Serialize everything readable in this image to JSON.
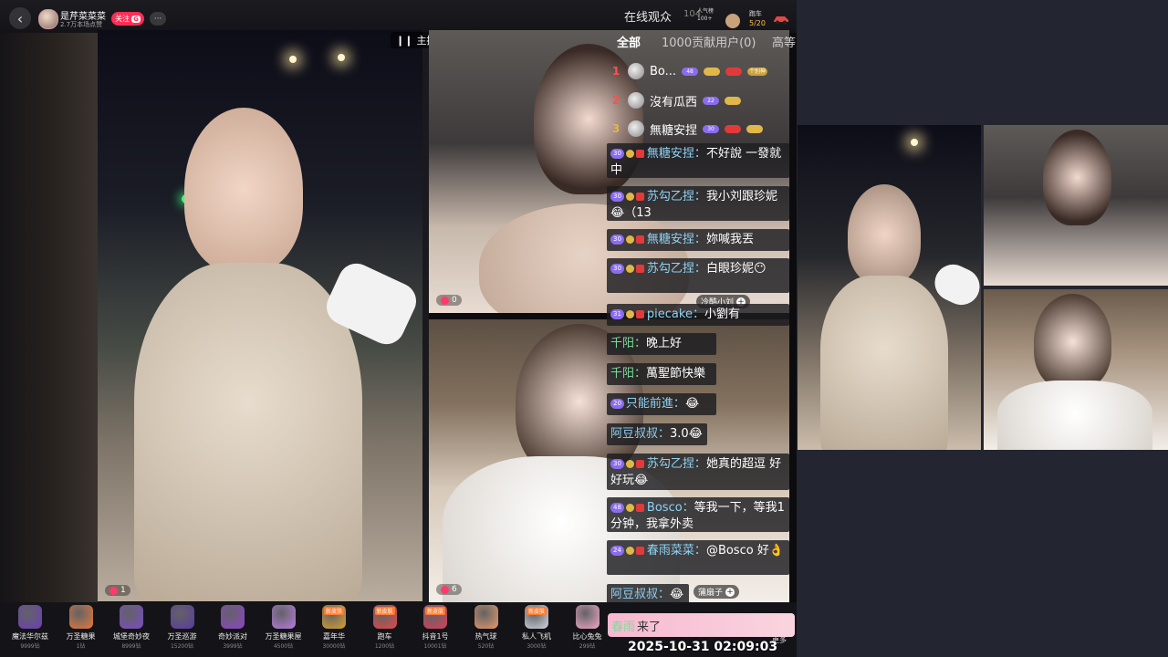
{
  "topbar": {
    "streamer_name": "是芹菜菜菜",
    "streamer_subtitle": "2.7万本场点赞",
    "follow_label": "关注",
    "follow_badge": "G",
    "more_label": "···",
    "audience_title": "在线观众",
    "audience_count": "104",
    "popularity_line1": "人气榜",
    "popularity_line2": "100+",
    "car_label": "跑车",
    "car_count": "5/20"
  },
  "stream": {
    "linking_label": "主播连线中",
    "main_badge_count": "1",
    "cohost_top_badge_count": "0",
    "cohost_bottom_badge_count": "6"
  },
  "chat_panel": {
    "tabs": [
      "全部",
      "1000贡献用户(0)",
      "高等"
    ],
    "top_contributors": [
      {
        "rank": "1",
        "name": "Bo...",
        "level": "48",
        "tag": "个别神"
      },
      {
        "rank": "2",
        "name": "沒有瓜西",
        "level": "22",
        "tag": ""
      },
      {
        "rank": "3",
        "name": "無糖安捏",
        "level": "30",
        "tag": ""
      }
    ],
    "messages": [
      {
        "level": "30",
        "nick": "無糖安捏：",
        "text": "不好說 一發就中"
      },
      {
        "level": "30",
        "nick": "苏勾乙捏：",
        "text": "我小刘跟珍妮😂（13"
      },
      {
        "level": "30",
        "nick": "無糖安捏：",
        "text": "妳喊我丟"
      },
      {
        "level": "30",
        "nick": "苏勾乙捏：",
        "text": "白眼珍妮😶"
      },
      {
        "level": "31",
        "nick": "piecake：",
        "text": "小劉有"
      },
      {
        "level": "",
        "nick": "千阳：",
        "text": "晚上好"
      },
      {
        "level": "",
        "nick": "千阳：",
        "text": "萬聖節快樂"
      },
      {
        "level": "20",
        "nick": "只能前進：",
        "text": "😂"
      },
      {
        "level": "",
        "nick": "阿豆叔叔：",
        "text": "3.0😂"
      },
      {
        "level": "30",
        "nick": "苏勾乙捏：",
        "text": "她真的超逗 好好玩😂"
      },
      {
        "level": "48",
        "nick": "Bosco：",
        "text": "等我一下，等我1分钟，我拿外卖"
      },
      {
        "level": "24",
        "nick": "春雨菜菜：",
        "text": "@Bosco 好👌"
      },
      {
        "level": "",
        "nick": "阿豆叔叔：",
        "text": "😂"
      }
    ],
    "pill_top": "冷酷小刘",
    "pill_bottom": "蒲扇子",
    "entry_banner_nick": "春雨",
    "entry_banner_text": "来了"
  },
  "timestamp": "2025-10-31 02:09:03",
  "gifts": [
    {
      "name": "魔法华尔兹",
      "price": "9999钻",
      "new": "",
      "color": "#6a3fb5"
    },
    {
      "name": "万圣糖果",
      "price": "1钻",
      "new": "",
      "color": "#e7783c"
    },
    {
      "name": "城堡奇妙夜",
      "price": "8999钻",
      "new": "",
      "color": "#7a4cc2"
    },
    {
      "name": "万圣巡游",
      "price": "15200钻",
      "new": "",
      "color": "#5b3aa0"
    },
    {
      "name": "奇妙派对",
      "price": "3999钻",
      "new": "",
      "color": "#8d44c9"
    },
    {
      "name": "万圣糖果屋",
      "price": "4500钻",
      "new": "",
      "color": "#b87be0"
    },
    {
      "name": "嘉年华",
      "price": "30000钻",
      "new": "新皮肤",
      "color": "#d7a22f"
    },
    {
      "name": "跑车",
      "price": "1200钻",
      "new": "新皮肤",
      "color": "#e24848"
    },
    {
      "name": "抖音1号",
      "price": "10001钻",
      "new": "新皮肤",
      "color": "#d6405b"
    },
    {
      "name": "热气球",
      "price": "520钻",
      "new": "",
      "color": "#e79a6a"
    },
    {
      "name": "私人飞机",
      "price": "3000钻",
      "new": "新皮肤",
      "color": "#cfd6e0"
    },
    {
      "name": "比心兔兔",
      "price": "299钻",
      "new": "",
      "color": "#f2a8c7"
    }
  ],
  "more_gifts_label": "更多"
}
